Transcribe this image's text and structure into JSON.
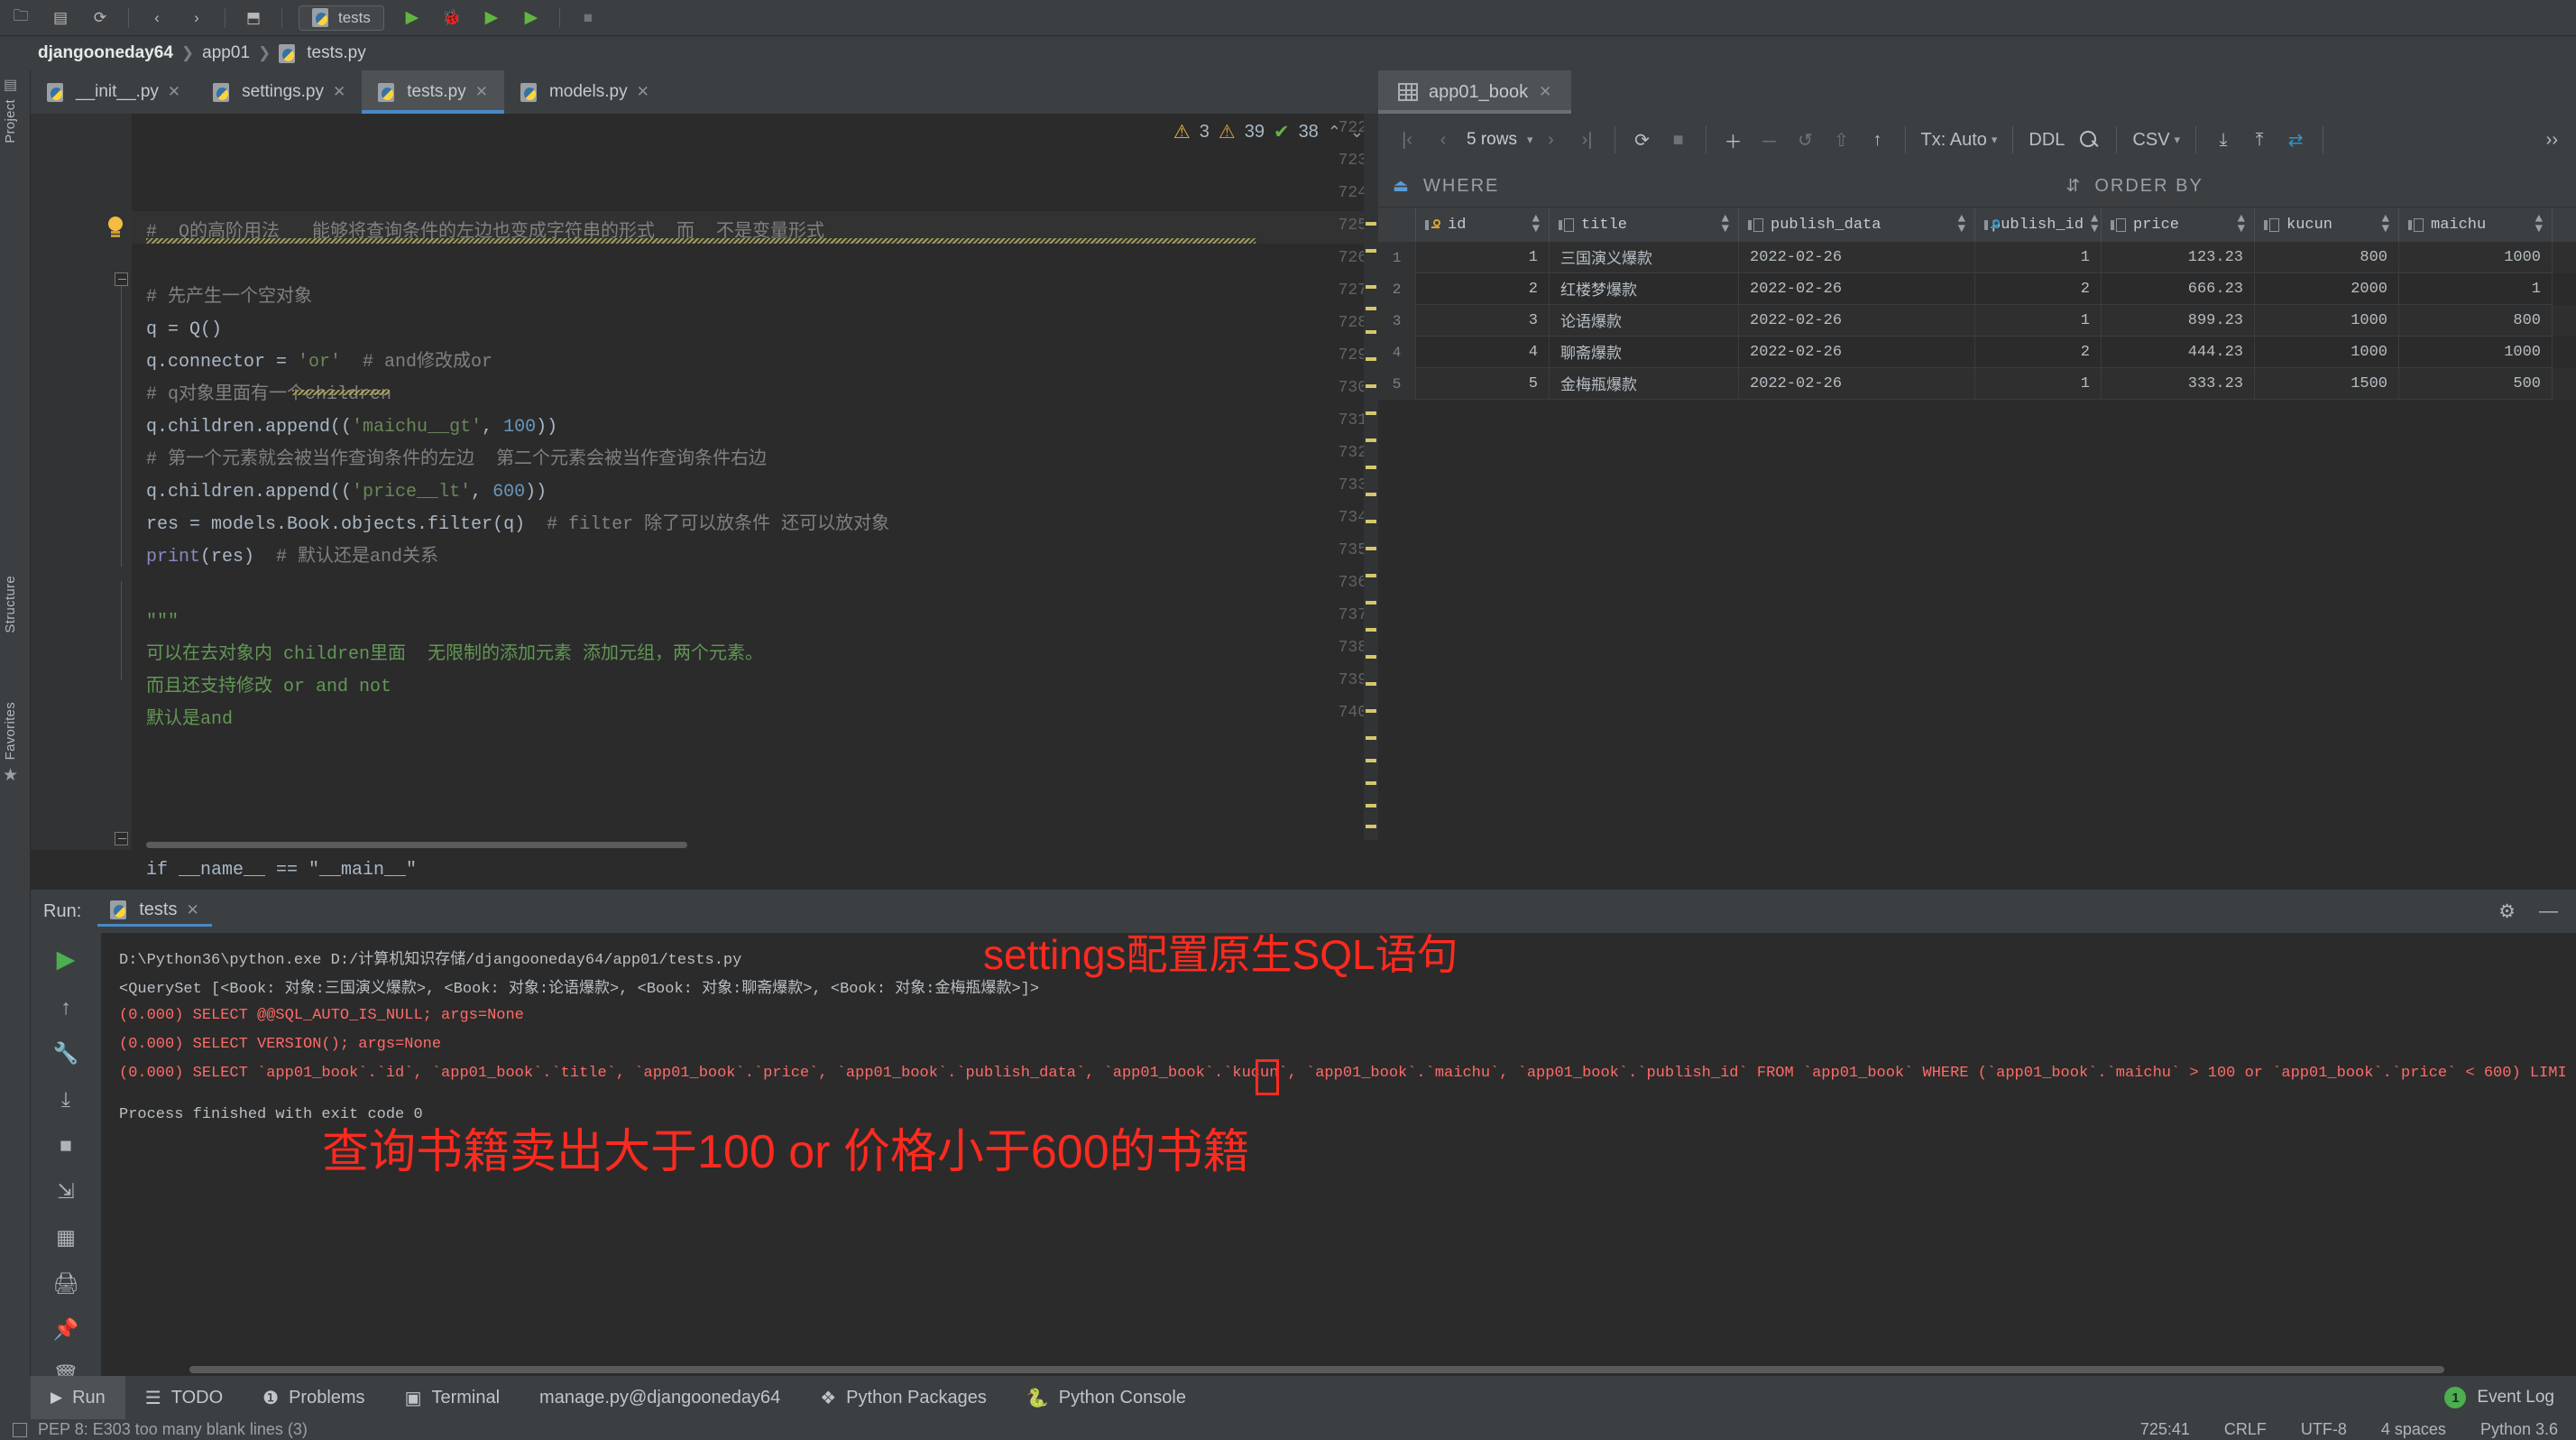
{
  "toolbar": {
    "run_config": "tests",
    "icons": [
      "open-folder-icon",
      "save-all-icon",
      "sync-icon",
      "back-icon",
      "forward-icon",
      "build-icon",
      "run-icon",
      "debug-icon",
      "coverage-icon",
      "profile-icon",
      "stop-icon",
      "search-everywhere-icon",
      "settings-icon"
    ]
  },
  "breadcrumb": {
    "project": "djangooneday64",
    "app": "app01",
    "file": "tests.py"
  },
  "rail": {
    "project": "Project",
    "structure": "Structure",
    "favorites": "Favorites"
  },
  "editor_tabs": [
    {
      "label": "__init__.py",
      "active": false
    },
    {
      "label": "settings.py",
      "active": false
    },
    {
      "label": "tests.py",
      "active": true
    },
    {
      "label": "models.py",
      "active": false
    }
  ],
  "inspection": {
    "warnings": "3",
    "weak_warnings": "39",
    "ok": "38"
  },
  "editor": {
    "first_line": 722,
    "highlight_line": 725,
    "lines": [
      {
        "n": 722,
        "segments": []
      },
      {
        "n": 723,
        "segments": []
      },
      {
        "n": 724,
        "segments": []
      },
      {
        "n": 725,
        "segments": [
          {
            "t": "#  Q的高阶用法   能够将查询条件的左边也变成字符串的形式  而  不是变量形式",
            "c": "cmt"
          }
        ]
      },
      {
        "n": 726,
        "segments": []
      },
      {
        "n": 727,
        "segments": [
          {
            "t": "# 先产生一个空对象",
            "c": "cmt"
          }
        ]
      },
      {
        "n": 728,
        "segments": [
          {
            "t": "q = Q()",
            "c": "id"
          }
        ]
      },
      {
        "n": 729,
        "segments": [
          {
            "t": "q.connector = ",
            "c": "id"
          },
          {
            "t": "'or'",
            "c": "str"
          },
          {
            "t": "  # and修改成or",
            "c": "cmt"
          }
        ]
      },
      {
        "n": 730,
        "segments": [
          {
            "t": "# q对象里面有一个children",
            "c": "cmt"
          }
        ]
      },
      {
        "n": 731,
        "segments": [
          {
            "t": "q.children.append((",
            "c": "id"
          },
          {
            "t": "'maichu__gt'",
            "c": "str"
          },
          {
            "t": ", ",
            "c": "id"
          },
          {
            "t": "100",
            "c": "num"
          },
          {
            "t": "))",
            "c": "id"
          }
        ]
      },
      {
        "n": 732,
        "segments": [
          {
            "t": "# 第一个元素就会被当作查询条件的左边  第二个元素会被当作查询条件右边",
            "c": "cmt"
          }
        ]
      },
      {
        "n": 733,
        "segments": [
          {
            "t": "q.children.append((",
            "c": "id"
          },
          {
            "t": "'price__lt'",
            "c": "str"
          },
          {
            "t": ", ",
            "c": "id"
          },
          {
            "t": "600",
            "c": "num"
          },
          {
            "t": "))",
            "c": "id"
          }
        ]
      },
      {
        "n": 734,
        "segments": [
          {
            "t": "res = models.Book.objects.filter(q)",
            "c": "id"
          },
          {
            "t": "  # filter 除了可以放条件 还可以放对象",
            "c": "cmt"
          }
        ]
      },
      {
        "n": 735,
        "segments": [
          {
            "t": "print",
            "c": "pv"
          },
          {
            "t": "(res)",
            "c": "id"
          },
          {
            "t": "  # 默认还是and关系",
            "c": "cmt"
          }
        ]
      },
      {
        "n": 736,
        "segments": []
      },
      {
        "n": 737,
        "segments": [
          {
            "t": "\"\"\"",
            "c": "doc"
          }
        ]
      },
      {
        "n": 738,
        "segments": [
          {
            "t": "可以在去对象内 children里面  无限制的添加元素 添加元组，两个元素。",
            "c": "doc"
          }
        ]
      },
      {
        "n": 739,
        "segments": [
          {
            "t": "而且还支持修改 or and not",
            "c": "doc"
          }
        ]
      },
      {
        "n": 740,
        "segments": [
          {
            "t": "默认是and",
            "c": "doc"
          }
        ]
      }
    ],
    "footer_line": "if __name__ == \"__main__\""
  },
  "database": {
    "tab_label": "app01_book",
    "toolbar": {
      "first_row": "first-row-icon",
      "prev_row": "prev-row-icon",
      "rows_label": "5 rows",
      "next_row": "next-row-icon",
      "last_row": "last-row-icon",
      "refresh": "refresh-icon",
      "stop": "stop-icon",
      "add_row": "add-row-icon",
      "delete_row": "delete-row-icon",
      "revert": "revert-icon",
      "revert_selected": "revert-selected-icon",
      "submit": "submit-icon",
      "tx_label": "Tx: Auto",
      "ddl_label": "DDL",
      "search": "search-icon",
      "csv_label": "CSV",
      "import": "import-icon",
      "export": "export-icon",
      "compare": "compare-icon",
      "more": "››"
    },
    "filter_bar": {
      "where": "WHERE",
      "order_by": "ORDER BY"
    },
    "columns": [
      {
        "name": "id",
        "pk": true
      },
      {
        "name": "title",
        "pk": false
      },
      {
        "name": "publish_data",
        "pk": false
      },
      {
        "name": "publish_id",
        "pk": true
      },
      {
        "name": "price",
        "pk": false
      },
      {
        "name": "kucun",
        "pk": false
      },
      {
        "name": "maichu",
        "pk": false
      }
    ],
    "rows": [
      {
        "no": "1",
        "id": "1",
        "title": "三国演义爆款",
        "publish_data": "2022-02-26",
        "publish_id": "1",
        "price": "123.23",
        "kucun": "800",
        "maichu": "1000"
      },
      {
        "no": "2",
        "id": "2",
        "title": "红楼梦爆款",
        "publish_data": "2022-02-26",
        "publish_id": "2",
        "price": "666.23",
        "kucun": "2000",
        "maichu": "1"
      },
      {
        "no": "3",
        "id": "3",
        "title": "论语爆款",
        "publish_data": "2022-02-26",
        "publish_id": "1",
        "price": "899.23",
        "kucun": "1000",
        "maichu": "800"
      },
      {
        "no": "4",
        "id": "4",
        "title": "聊斋爆款",
        "publish_data": "2022-02-26",
        "publish_id": "2",
        "price": "444.23",
        "kucun": "1000",
        "maichu": "1000"
      },
      {
        "no": "5",
        "id": "5",
        "title": "金梅瓶爆款",
        "publish_data": "2022-02-26",
        "publish_id": "1",
        "price": "333.23",
        "kucun": "1500",
        "maichu": "500"
      }
    ]
  },
  "run_window": {
    "title": "Run:",
    "tab_label": "tests",
    "rail_icons": [
      "run-icon",
      "rerun-up-icon",
      "wrench-icon",
      "scroll-down-icon",
      "stop-icon",
      "soft-wrap-icon",
      "grid-icon",
      "print-icon",
      "pin-icon",
      "trash-icon"
    ],
    "header_icons": [
      "settings-gear-icon",
      "minimize-icon"
    ],
    "console": {
      "line1": "D:\\Python36\\python.exe D:/计算机知识存储/djangooneday64/app01/tests.py",
      "line2": "<QuerySet [<Book: 对象:三国演义爆款>, <Book: 对象:论语爆款>, <Book: 对象:聊斋爆款>, <Book: 对象:金梅瓶爆款>]>",
      "line3": "(0.000) SELECT @@SQL_AUTO_IS_NULL; args=None",
      "line4": "(0.000) SELECT VERSION(); args=None",
      "line5_a": "(0.000) SELECT `app01_book`.`id`, `app01_book`.`title`, `app01_book`.`price`, `app01_book`.`publish_data`, `app01_book`.`kucun`, `app01_book`.`maichu`, `app01_book`.`publish_id` FROM `app01_book` WHERE (`app01_book`.`maichu` > 100 ",
      "line5_b": "or",
      "line5_c": " `app01_book`.`price` < 600) LIMI",
      "line6": "Process finished with exit code 0"
    },
    "annotations": {
      "top_right": "settings配置原生SQL语句",
      "bottom": "查询书籍卖出大于100 or 价格小于600的书籍"
    }
  },
  "status_bar": {
    "items": [
      {
        "label": "Run",
        "icon": "play-icon",
        "active": true
      },
      {
        "label": "TODO",
        "icon": "todo-list-icon",
        "active": false
      },
      {
        "label": "Problems",
        "icon": "problems-icon",
        "active": false
      },
      {
        "label": "Terminal",
        "icon": "terminal-icon",
        "active": false
      },
      {
        "label": "manage.py@djangooneday64",
        "icon": "",
        "active": false
      },
      {
        "label": "Python Packages",
        "icon": "packages-icon",
        "active": false
      },
      {
        "label": "Python Console",
        "icon": "python-icon",
        "active": false
      }
    ],
    "event_log": {
      "count": "1",
      "label": "Event Log"
    }
  },
  "pep_bar": {
    "message": "PEP 8: E303 too many blank lines (3)",
    "caret": "725:41",
    "line_sep": "CRLF",
    "encoding": "UTF-8",
    "indent": "4 spaces",
    "interpreter": "Python 3.6"
  },
  "colors": {
    "accent_blue": "#4a88c7",
    "annotation_red": "#ff2a1f",
    "console_red": "#ff6b68",
    "string_green": "#6a8759",
    "number_blue": "#6897bb"
  }
}
